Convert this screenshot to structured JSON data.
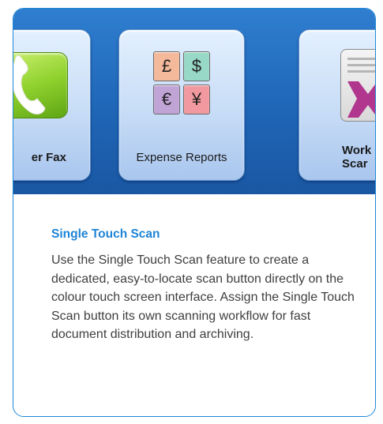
{
  "tiles": {
    "fax": {
      "label": "er Fax",
      "icon": "phone-handset-icon",
      "icon_color": "#8fd12d"
    },
    "expense": {
      "label": "Expense Reports",
      "icon": "currency-grid-icon",
      "currencies": [
        {
          "symbol": "£",
          "color": "#f4b89a"
        },
        {
          "symbol": "$",
          "color": "#98d8c6"
        },
        {
          "symbol": "€",
          "color": "#c1a4d6"
        },
        {
          "symbol": "¥",
          "color": "#f2999f"
        }
      ]
    },
    "workflow": {
      "label_line1": "Work",
      "label_line2": "Scar",
      "icon": "workflow-document-icon",
      "icon_color": "#b0368e"
    }
  },
  "feature": {
    "title": "Single Touch Scan",
    "description": "Use the Single Touch Scan feature to create a dedicated, easy-to-locate scan button directly on the colour touch screen interface. Assign the Single Touch Scan button its own scanning workflow for fast document distribution and archiving."
  },
  "colors": {
    "banner_blue": "#1f66b6",
    "accent_blue": "#1d84d6",
    "body_text": "#3f3f3f"
  }
}
